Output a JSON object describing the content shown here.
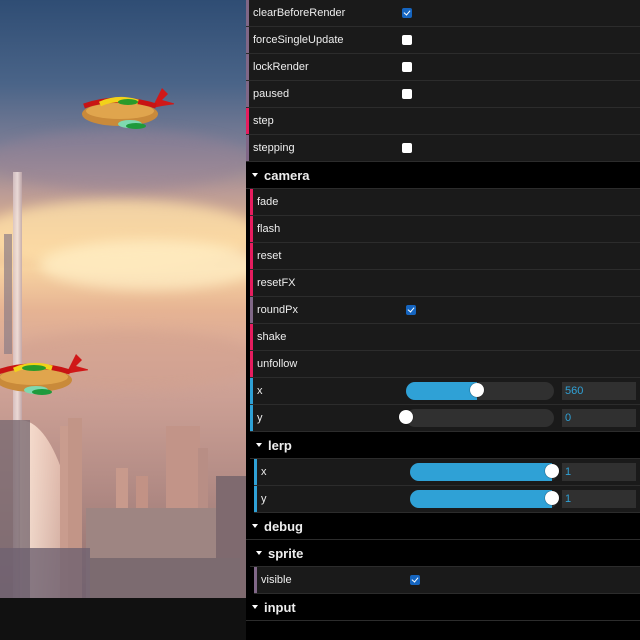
{
  "game": {
    "sprites": [
      {
        "name": "hotdog-airship-1"
      },
      {
        "name": "hotdog-airship-2"
      }
    ]
  },
  "gui": {
    "rows_top": [
      {
        "label": "clearBeforeRender",
        "type": "boolean",
        "checked": true
      },
      {
        "label": "forceSingleUpdate",
        "type": "boolean",
        "checked": false
      },
      {
        "label": "lockRender",
        "type": "boolean",
        "checked": false
      },
      {
        "label": "paused",
        "type": "boolean",
        "checked": false
      },
      {
        "label": "step",
        "type": "function"
      },
      {
        "label": "stepping",
        "type": "boolean",
        "checked": false
      }
    ],
    "camera": {
      "title": "camera",
      "rows": [
        {
          "label": "fade",
          "type": "function"
        },
        {
          "label": "flash",
          "type": "function"
        },
        {
          "label": "reset",
          "type": "function"
        },
        {
          "label": "resetFX",
          "type": "function"
        },
        {
          "label": "roundPx",
          "type": "boolean",
          "checked": true
        },
        {
          "label": "shake",
          "type": "function"
        },
        {
          "label": "unfollow",
          "type": "function"
        }
      ],
      "x": {
        "label": "x",
        "value": "560",
        "fraction": 0.5
      },
      "y": {
        "label": "y",
        "value": "0",
        "fraction": 0.0
      },
      "lerp": {
        "title": "lerp",
        "x": {
          "label": "x",
          "value": "1",
          "fraction": 1.0
        },
        "y": {
          "label": "y",
          "value": "1",
          "fraction": 1.0
        }
      }
    },
    "debug": {
      "title": "debug",
      "sprite": {
        "title": "sprite",
        "visible": {
          "label": "visible",
          "checked": true
        }
      }
    },
    "input": {
      "title": "input"
    }
  },
  "colors": {
    "function_accent": "#e61d5f",
    "boolean_accent": "#806787",
    "number_accent": "#2fa1d6",
    "checkbox_checked": "#1565c0"
  }
}
